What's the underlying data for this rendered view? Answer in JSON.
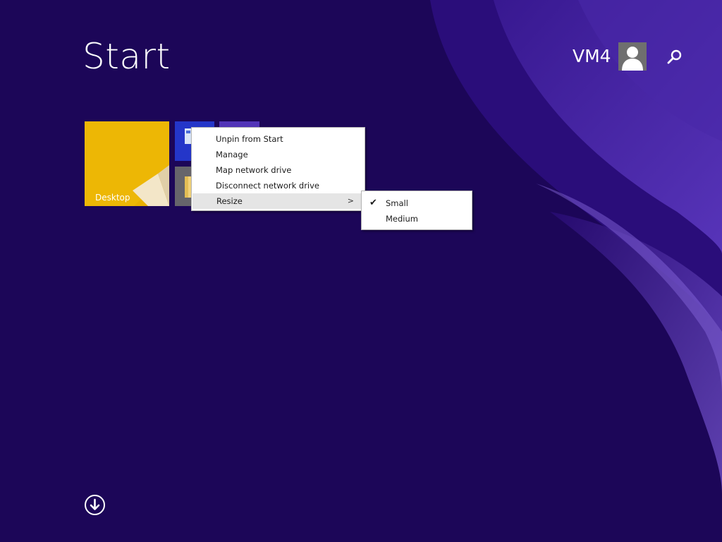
{
  "start": {
    "title": "Start"
  },
  "user": {
    "name": "VM4",
    "avatar_icon": "user-avatar-icon"
  },
  "search": {
    "icon": "search-icon"
  },
  "tiles": {
    "desktop_label": "Desktop",
    "desktop_color": "#e9b000"
  },
  "context_menu": {
    "items": [
      {
        "label": "Unpin from Start"
      },
      {
        "label": "Manage"
      },
      {
        "label": "Map network drive"
      },
      {
        "label": "Disconnect network drive"
      },
      {
        "label": "Resize",
        "submenu_arrow": ">"
      }
    ]
  },
  "resize_submenu": {
    "items": [
      {
        "label": "Small",
        "checked": true,
        "check_glyph": "✔"
      },
      {
        "label": "Medium",
        "checked": false
      }
    ]
  },
  "apps_view": {
    "icon": "arrow-down-circle-icon"
  },
  "colors": {
    "background": "#1c0658",
    "menu_highlight": "#e5e5e5"
  }
}
